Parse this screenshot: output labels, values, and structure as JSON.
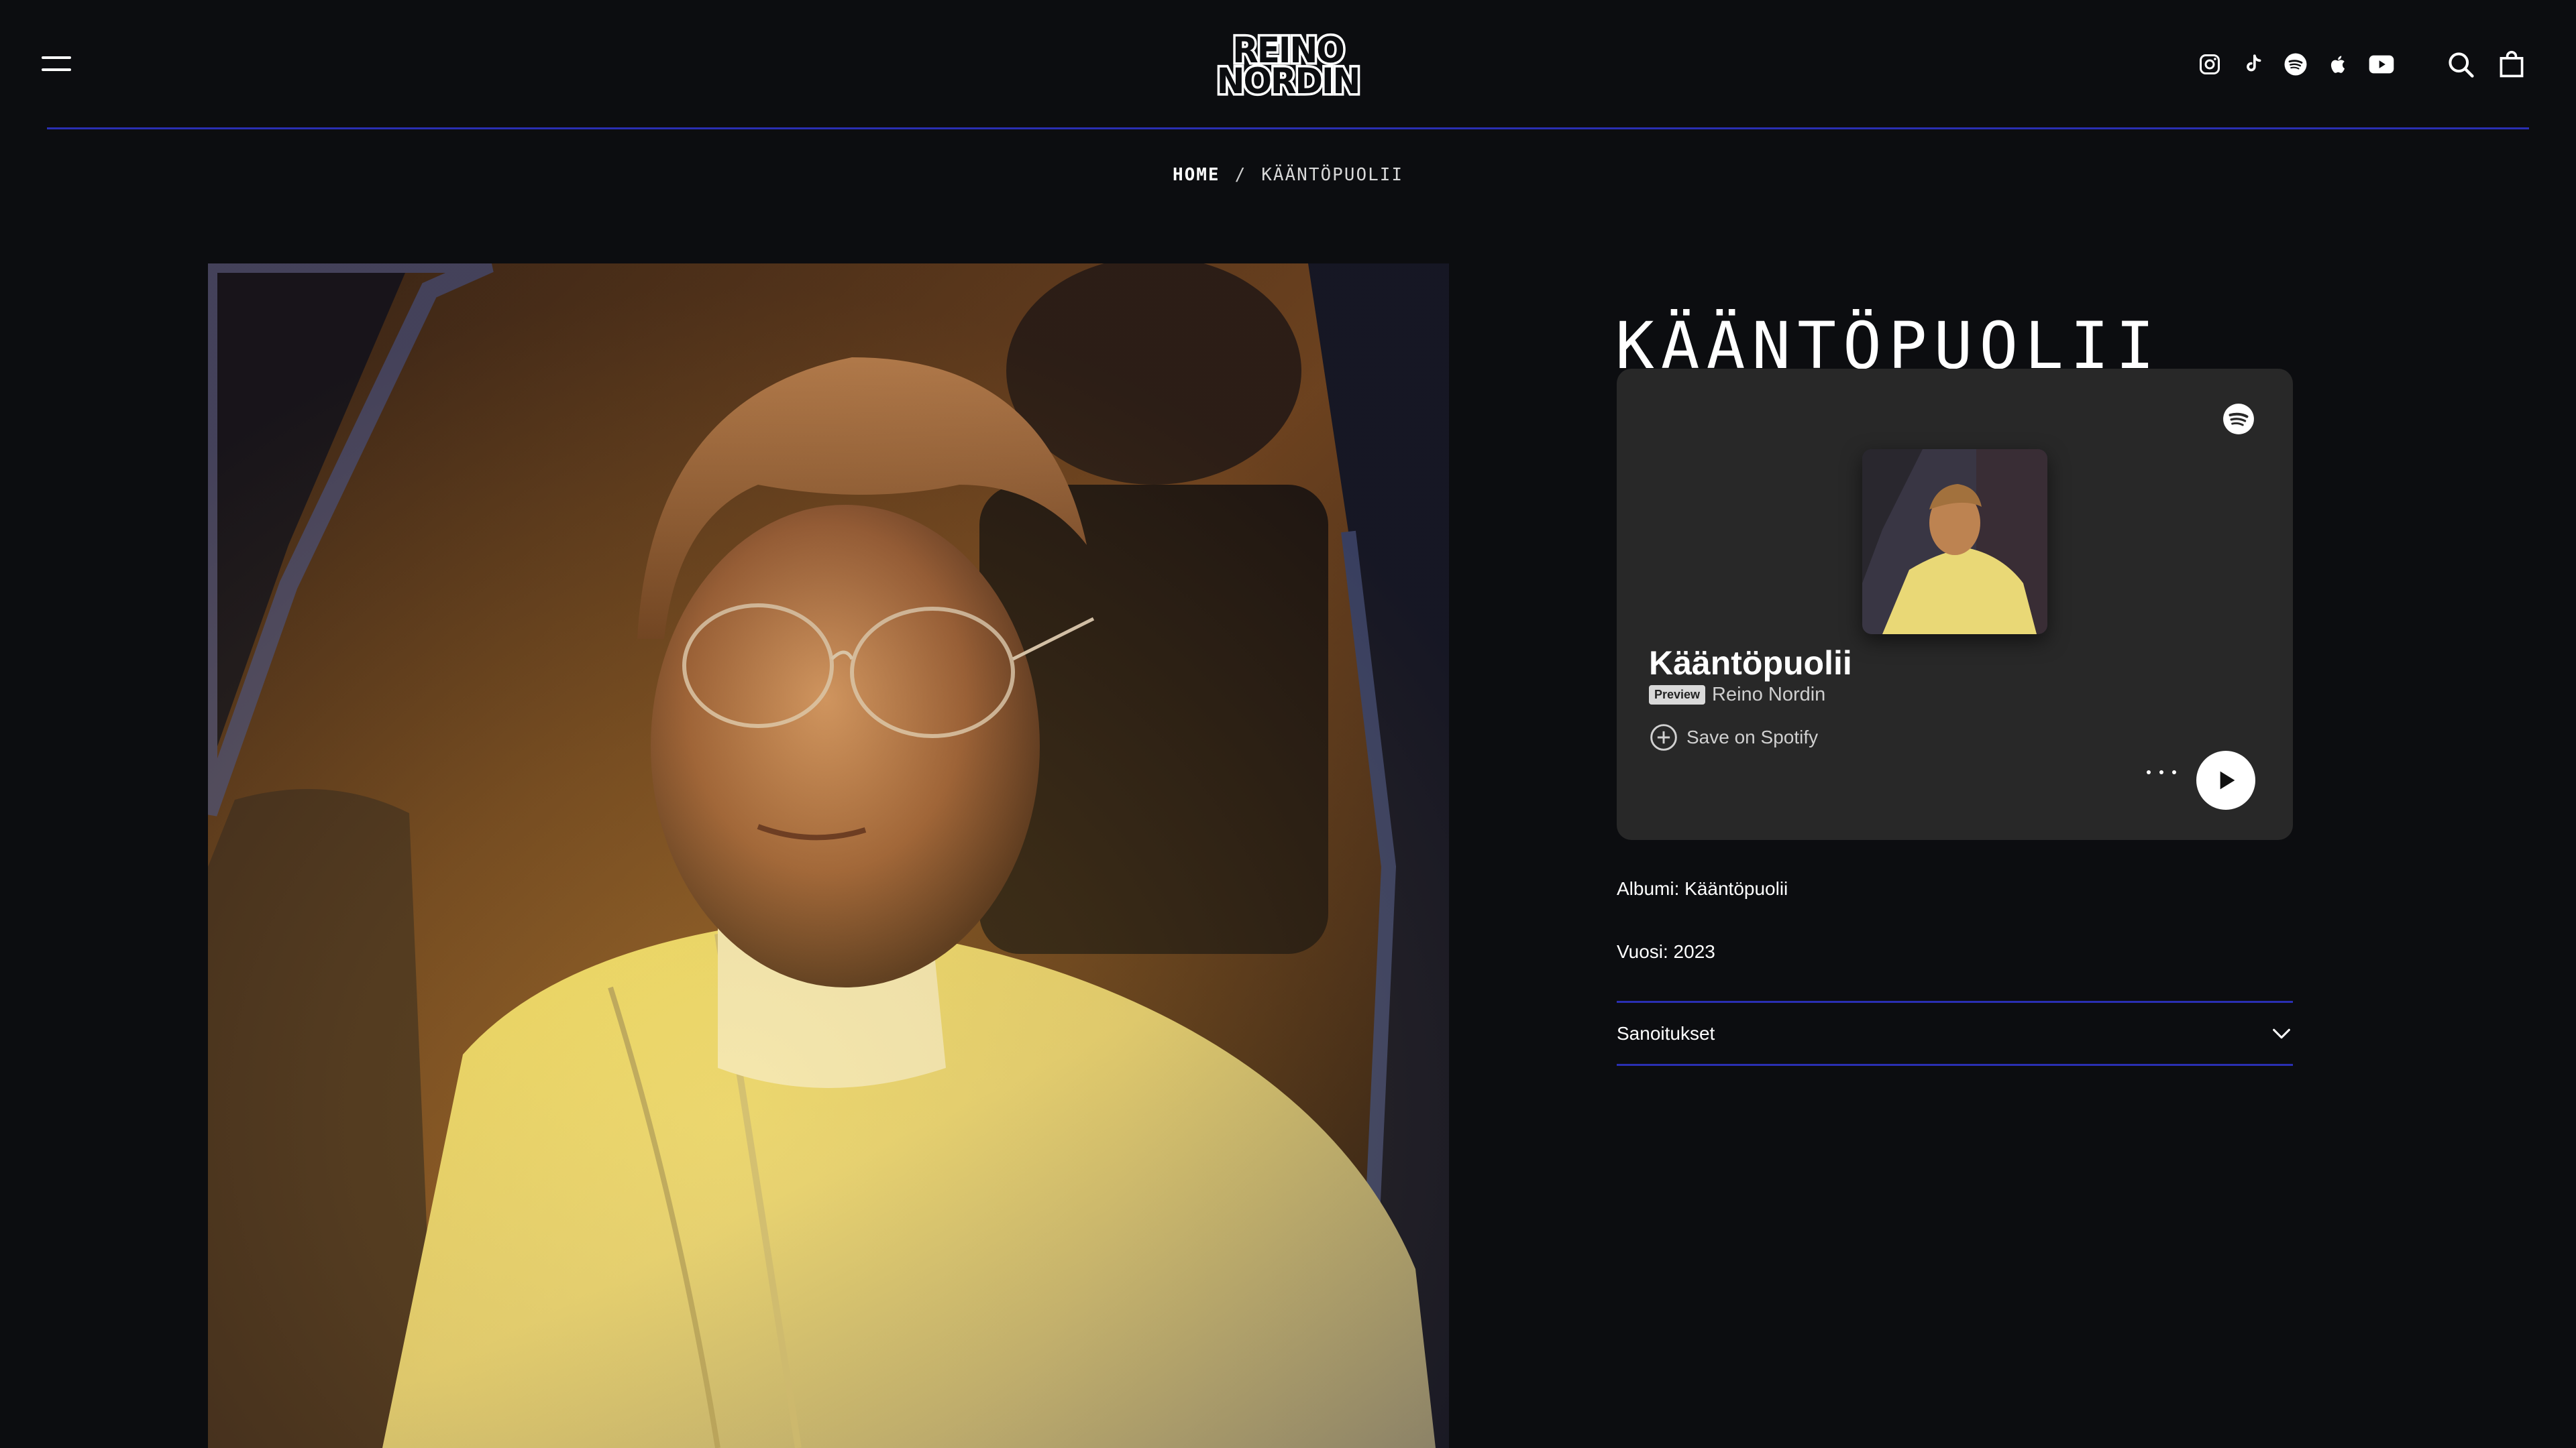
{
  "header": {
    "logo": {
      "line1": "REINO",
      "line2": "NORDIN"
    },
    "social_icons": [
      "instagram-icon",
      "tiktok-icon",
      "spotify-icon",
      "apple-icon",
      "youtube-icon"
    ],
    "utility_icons": [
      "search-icon",
      "shopping-bag-icon"
    ],
    "menu_icon": "menu-icon",
    "accent_color": "#2a2fb3"
  },
  "breadcrumb": {
    "home": "HOME",
    "separator": "/",
    "current": "KÄÄNTÖPUOLII"
  },
  "product": {
    "title": "KÄÄNTÖPUOLII",
    "album_line": "Albumi: Kääntöpuolii",
    "year_line": "Vuosi: 2023",
    "lyrics_label": "Sanoitukset"
  },
  "spotify_embed": {
    "track_title": "Kääntöpuolii",
    "badge": "Preview",
    "artist": "Reino Nordin",
    "save_label": "Save on Spotify",
    "background": "#282828"
  }
}
